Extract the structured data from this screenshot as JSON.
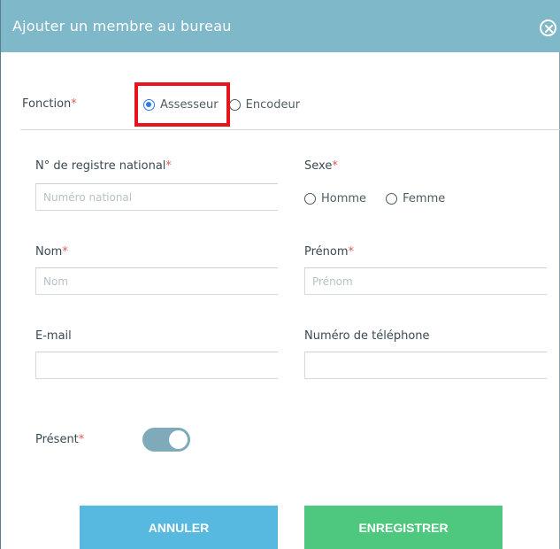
{
  "dialog": {
    "title": "Ajouter un membre au bureau",
    "close_icon": "close-circle-icon"
  },
  "fonction": {
    "label": "Fonction",
    "required_mark": "*",
    "options": [
      {
        "label": "Assesseur",
        "checked": true
      },
      {
        "label": "Encodeur",
        "checked": false
      }
    ]
  },
  "registre": {
    "label": "N° de registre national",
    "required_mark": "*",
    "placeholder": "Numéro national",
    "value": ""
  },
  "sexe": {
    "label": "Sexe",
    "required_mark": "*",
    "options": [
      {
        "label": "Homme",
        "checked": false
      },
      {
        "label": "Femme",
        "checked": false
      }
    ]
  },
  "nom": {
    "label": "Nom",
    "required_mark": "*",
    "placeholder": "Nom",
    "value": ""
  },
  "prenom": {
    "label": "Prénom",
    "required_mark": "*",
    "placeholder": "Prénom",
    "value": ""
  },
  "email": {
    "label": "E-mail",
    "placeholder": "",
    "value": ""
  },
  "telephone": {
    "label": "Numéro de téléphone",
    "placeholder": "",
    "value": ""
  },
  "present": {
    "label": "Présent",
    "required_mark": "*",
    "on": true
  },
  "buttons": {
    "cancel": "ANNULER",
    "save": "ENREGISTRER"
  },
  "colors": {
    "header": "#7eb8c9",
    "required": "#e05a5a",
    "radio_selected": "#2c7be5",
    "highlight": "#e8141b",
    "toggle_on": "#7eaab9",
    "cancel_button": "#57b8e0",
    "save_button": "#4fc87f"
  }
}
